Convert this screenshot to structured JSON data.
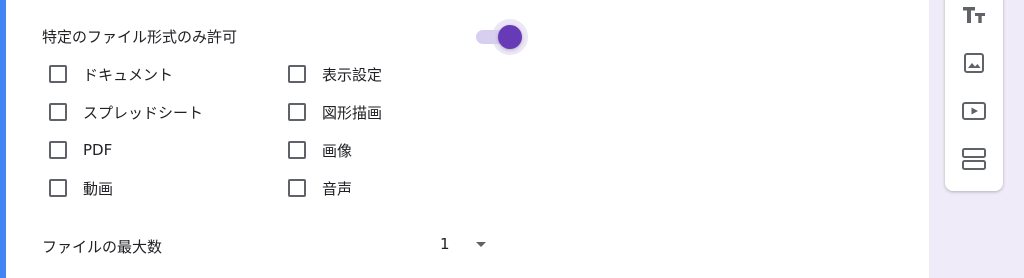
{
  "form": {
    "allow_types_label": "特定のファイル形式のみ許可",
    "allow_types_enabled": true,
    "file_types": [
      {
        "label": "ドキュメント",
        "checked": false
      },
      {
        "label": "表示設定",
        "checked": false
      },
      {
        "label": "スプレッドシート",
        "checked": false
      },
      {
        "label": "図形描画",
        "checked": false
      },
      {
        "label": "PDF",
        "checked": false
      },
      {
        "label": "画像",
        "checked": false
      },
      {
        "label": "動画",
        "checked": false
      },
      {
        "label": "音声",
        "checked": false
      }
    ],
    "max_files_label": "ファイルの最大数",
    "max_files_value": "1"
  },
  "sidebar": {
    "tools": [
      {
        "icon": "add-title-icon"
      },
      {
        "icon": "add-image-icon"
      },
      {
        "icon": "add-video-icon"
      },
      {
        "icon": "add-section-icon"
      }
    ]
  },
  "colors": {
    "accent": "#673ab7",
    "card_border": "#4285f4",
    "background": "#f0ebf8"
  }
}
